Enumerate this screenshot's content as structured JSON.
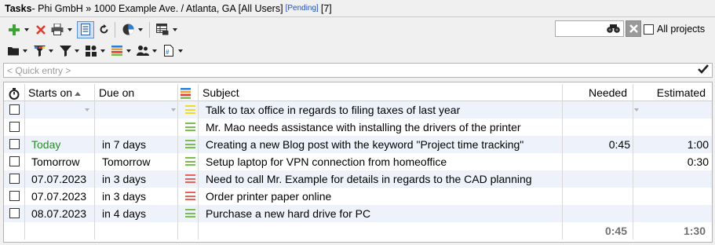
{
  "title": {
    "main": "Tasks",
    "context": " - Phi GmbH » 1000 Example Ave. / Atlanta, GA [All Users] ",
    "pending": "[Pending]",
    "count": "[7]"
  },
  "toolbar": {
    "all_projects_label": "All projects",
    "search_value": ""
  },
  "quick_entry": {
    "placeholder": "< Quick entry >"
  },
  "columns": {
    "starts_on": "Starts on",
    "due_on": "Due on",
    "subject": "Subject",
    "needed": "Needed",
    "estimated": "Estimated"
  },
  "colors": {
    "priority_normal": "#7bbd4f",
    "priority_high": "#e8615a",
    "priority_note": "#f2d92e",
    "today": "#2a8a2a"
  },
  "rows": [
    {
      "starts": "",
      "due": "",
      "subject": "Talk to tax office in regards to filing taxes of last year",
      "needed": "",
      "estimated": "",
      "priority": "note"
    },
    {
      "starts": "",
      "due": "",
      "subject": "Mr. Mao needs assistance with installing the drivers of the printer",
      "needed": "",
      "estimated": "",
      "priority": "normal"
    },
    {
      "starts": "Today",
      "due": "in 7 days",
      "subject": "Creating a new Blog post with the keyword \"Project time tracking\"",
      "needed": "0:45",
      "estimated": "1:00",
      "priority": "normal"
    },
    {
      "starts": "Tomorrow",
      "due": "Tomorrow",
      "subject": "Setup laptop for VPN connection from homeoffice",
      "needed": "",
      "estimated": "0:30",
      "priority": "normal"
    },
    {
      "starts": "07.07.2023",
      "due": "in 3 days",
      "subject": "Need to call Mr. Example for details in regards to the CAD planning",
      "needed": "",
      "estimated": "",
      "priority": "high"
    },
    {
      "starts": "07.07.2023",
      "due": "in 3 days",
      "subject": "Order printer paper online",
      "needed": "",
      "estimated": "",
      "priority": "high"
    },
    {
      "starts": "08.07.2023",
      "due": "in 4 days",
      "subject": "Purchase a new hard drive for PC",
      "needed": "",
      "estimated": "",
      "priority": "normal"
    }
  ],
  "totals": {
    "needed": "0:45",
    "estimated": "1:30"
  }
}
